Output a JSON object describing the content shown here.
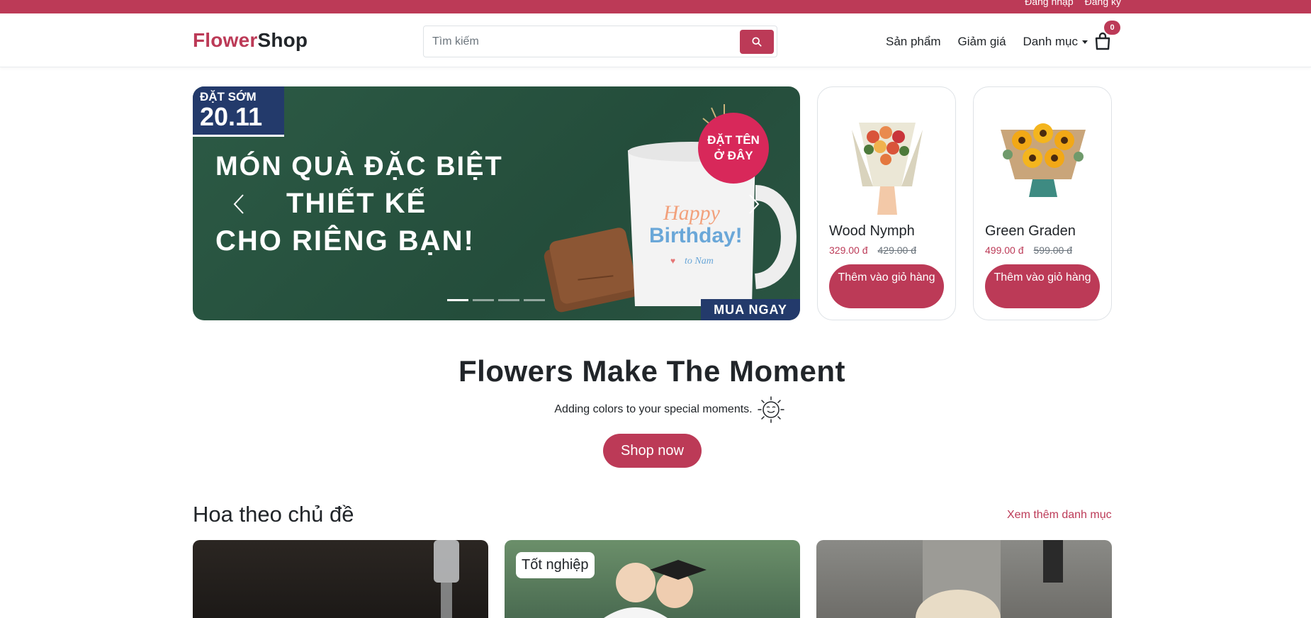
{
  "topbar": {
    "login": "Đăng nhập",
    "register": "Đăng ký"
  },
  "header": {
    "brand_part1": "Flower",
    "brand_part2": "Shop",
    "search_placeholder": "Tìm kiếm",
    "nav": {
      "products": "Sản phẩm",
      "sale": "Giảm giá",
      "categories": "Danh mục"
    },
    "cart_count": "0"
  },
  "banner": {
    "promo_label": "ĐẶT SỚM",
    "promo_date": "20.11",
    "line1": "MÓN QUÀ ĐẶC BIỆT",
    "line2": "THIẾT KẾ",
    "line3": "CHO RIÊNG BẠN!",
    "badge_line1": "ĐẶT TÊN",
    "badge_line2": "Ở ĐÂY",
    "mug_text1": "Happy",
    "mug_text2": "Birthday!",
    "mug_text3": "to Nam",
    "cta": "MUA NGAY",
    "slide_count": 4,
    "active_slide": 1
  },
  "products": [
    {
      "name": "Wood Nymph",
      "price": "329.00 đ",
      "old_price": "429.00 đ",
      "button": "Thêm vào giỏ hàng"
    },
    {
      "name": "Green Graden",
      "price": "499.00 đ",
      "old_price": "599.00 đ",
      "button": "Thêm vào giỏ hàng"
    }
  ],
  "hero": {
    "title": "Flowers Make The Moment",
    "subtitle": "Adding colors to your special moments.",
    "button": "Shop now"
  },
  "section": {
    "title": "Hoa theo chủ đề",
    "more_link": "Xem thêm danh mục",
    "categories": [
      {
        "label": ""
      },
      {
        "label": "Tốt nghiệp"
      },
      {
        "label": ""
      }
    ]
  },
  "colors": {
    "accent": "#bc3a57",
    "banner_bg": "#2c5a45",
    "tag_blue": "#233a6b",
    "badge_pink": "#d8285a"
  }
}
